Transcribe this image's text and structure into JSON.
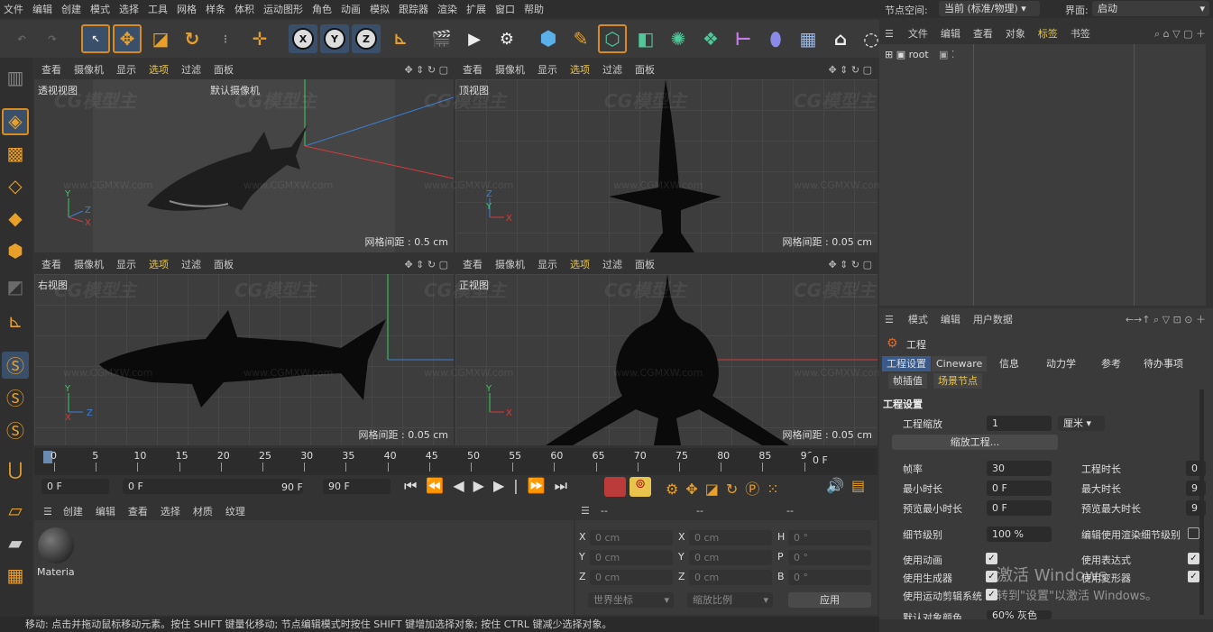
{
  "menu": [
    "文件",
    "编辑",
    "创建",
    "模式",
    "选择",
    "工具",
    "网格",
    "样条",
    "体积",
    "运动图形",
    "角色",
    "动画",
    "模拟",
    "跟踪器",
    "渲染",
    "扩展",
    "窗口",
    "帮助"
  ],
  "top_right": {
    "node_space_label": "节点空间:",
    "node_space_value": "当前 (标准/物理)",
    "layout_label": "界面:",
    "layout_value": "启动"
  },
  "toolbar": {
    "x": "X",
    "y": "Y",
    "z": "Z"
  },
  "viewports": [
    {
      "menus": [
        "查看",
        "摄像机",
        "显示",
        "选项",
        "过滤",
        "面板"
      ],
      "label": "透视视图",
      "camera": "默认摄像机",
      "grid": "网格间距 : 0.5 cm"
    },
    {
      "menus": [
        "查看",
        "摄像机",
        "显示",
        "选项",
        "过滤",
        "面板"
      ],
      "label": "顶视图",
      "grid": "网格间距 : 0.05 cm"
    },
    {
      "menus": [
        "查看",
        "摄像机",
        "显示",
        "选项",
        "过滤",
        "面板"
      ],
      "label": "右视图",
      "grid": "网格间距 : 0.05 cm"
    },
    {
      "menus": [
        "查看",
        "摄像机",
        "显示",
        "选项",
        "过滤",
        "面板"
      ],
      "label": "正视图",
      "grid": "网格间距 : 0.05 cm"
    }
  ],
  "axis": {
    "x": "X",
    "y": "Y",
    "z": "Z"
  },
  "watermark": {
    "logo": "CG模型主",
    "url": "www.CGMXW.com"
  },
  "timeline": {
    "ticks": [
      "0",
      "5",
      "10",
      "15",
      "20",
      "25",
      "30",
      "35",
      "40",
      "45",
      "50",
      "55",
      "60",
      "65",
      "70",
      "75",
      "80",
      "85",
      "90"
    ],
    "current": "0 F"
  },
  "transport": {
    "start": "0 F",
    "range_start": "0 F",
    "range_end": "90 F",
    "end": "90 F"
  },
  "material_panel": {
    "menus": [
      "创建",
      "编辑",
      "查看",
      "选择",
      "材质",
      "纹理"
    ],
    "material_name": "Materia"
  },
  "coord_panel": {
    "headers": [
      "--",
      "--",
      "--"
    ],
    "rows": [
      {
        "a": "X",
        "av": "0 cm",
        "b": "X",
        "bv": "0 cm",
        "c": "H",
        "cv": "0 °"
      },
      {
        "a": "Y",
        "av": "0 cm",
        "b": "Y",
        "bv": "0 cm",
        "c": "P",
        "cv": "0 °"
      },
      {
        "a": "Z",
        "av": "0 cm",
        "b": "Z",
        "bv": "0 cm",
        "c": "B",
        "cv": "0 °"
      }
    ],
    "world": "世界坐标",
    "scale": "缩放比例",
    "apply": "应用"
  },
  "object_panel": {
    "menus": [
      "文件",
      "编辑",
      "查看",
      "对象",
      "标签",
      "书签"
    ],
    "root": "root"
  },
  "attr_panel": {
    "menus": [
      "模式",
      "编辑",
      "用户数据"
    ],
    "title": "工程",
    "tabs1": [
      "工程设置",
      "Cineware",
      "信息",
      "动力学",
      "参考",
      "待办事项"
    ],
    "tabs2": [
      "帧插值",
      "场景节点"
    ],
    "section": "工程设置",
    "scale_label": "工程缩放",
    "scale_value": "1",
    "scale_unit": "厘米",
    "scale_btn": "缩放工程...",
    "fps_label": "帧率",
    "fps_value": "30",
    "duration_label": "工程时长",
    "duration_value": "0",
    "min_label": "最小时长",
    "min_value": "0 F",
    "max_label": "最大时长",
    "max_value": "9",
    "pmin_label": "预览最小时长",
    "pmin_value": "0 F",
    "pmax_label": "预览最大时长",
    "pmax_value": "9",
    "lod_label": "细节级别",
    "lod_value": "100 %",
    "lod_render_label": "编辑使用渲染细节级别",
    "anim_label": "使用动画",
    "expr_label": "使用表达式",
    "gen_label": "使用生成器",
    "deform_label": "使用变形器",
    "motion_label": "使用运动剪辑系统",
    "default_color_label": "默认对象颜色",
    "default_color_value": "60% 灰色",
    "activate1": "激活 Windows",
    "activate2": "转到\"设置\"以激活 Windows。"
  },
  "status_text": "移动: 点击并拖动鼠标移动元素。按住 SHIFT 键量化移动; 节点编辑模式时按住 SHIFT 键增加选择对象; 按住 CTRL 键减少选择对象。"
}
